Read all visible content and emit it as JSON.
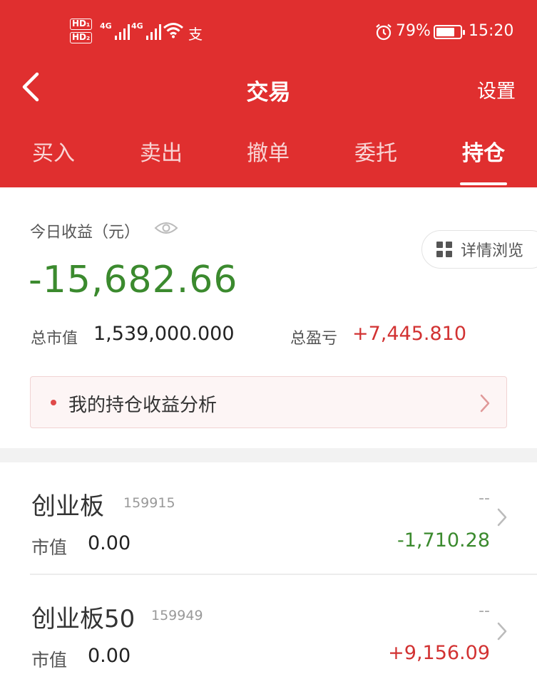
{
  "status_bar": {
    "sim1": "HD₁",
    "sim2": "HD₂",
    "net1": "4G",
    "net2": "4G",
    "pay_icon_glyph": "支",
    "battery": "79%",
    "battery_level": 0.79,
    "time": "15:20"
  },
  "nav": {
    "title": "交易",
    "settings": "设置"
  },
  "tabs": [
    {
      "label": "买入"
    },
    {
      "label": "卖出"
    },
    {
      "label": "撤单"
    },
    {
      "label": "委托"
    },
    {
      "label": "持仓",
      "active": true
    }
  ],
  "summary": {
    "today_label": "今日收益（元）",
    "today_value": "-15,682.66",
    "detail_button": "详情浏览",
    "market_value_label": "总市值",
    "market_value": "1,539,000.000",
    "total_pl_label": "总盈亏",
    "total_pl": "+7,445.810",
    "analysis_label": "我的持仓收益分析"
  },
  "holdings": [
    {
      "name": "创业板",
      "code": "159915",
      "price": "--",
      "market_label": "市值",
      "market_value": "0.00",
      "pl": "-1,710.28"
    },
    {
      "name": "创业板50",
      "code": "159949",
      "price": "--",
      "market_label": "市值",
      "market_value": "0.00",
      "pl": "+9,156.09"
    }
  ],
  "colors": {
    "brand_red": "#e02f2f",
    "loss_green": "#3b8a2e",
    "gain_red": "#d23232"
  },
  "icons": {
    "back": "chevron-left-icon",
    "eye": "eye-icon",
    "detail": "grid-icon",
    "row_arrow": "chevron-right-icon",
    "alarm": "alarm-icon",
    "wifi": "wifi-icon",
    "battery": "battery-icon"
  }
}
